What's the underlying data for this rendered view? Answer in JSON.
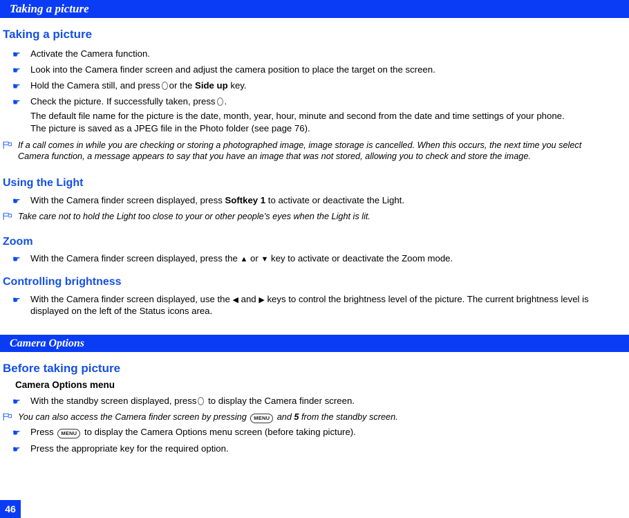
{
  "document": {
    "header_title": "Taking a picture",
    "page_number": "46"
  },
  "sections": {
    "taking_a_picture": {
      "heading": "Taking a picture",
      "steps": [
        "Activate the Camera function.",
        "Look into the Camera finder screen and adjust the camera position to place the target on the screen.",
        "Hold the Camera still, and press",
        "Check the picture. If successfully taken, press"
      ],
      "step3_suffix_a": "or the",
      "step3_bold": "Side up",
      "step3_suffix_b": "key.",
      "step4_suffix": ".",
      "continuation": [
        "The default file name for the picture is the date, month, year, hour, minute and second from the date and time settings of your phone.",
        "The picture is saved as a JPEG file in the Photo folder (see page 76)."
      ],
      "note_line1": "If a call comes in while you are checking or storing a photographed image, image storage is cancelled. When this occurs, the next time you select",
      "note_line2": "Camera function, a message appears to say that you have an image that was not stored, allowing you to check and store the image."
    },
    "using_the_light": {
      "heading": "Using the Light",
      "step_prefix": "With the Camera finder screen displayed, press",
      "step_bold": "Softkey 1",
      "step_suffix": "to activate or deactivate the Light.",
      "note": "Take care not to hold the Light too close to your or other people’s eyes when the Light is lit."
    },
    "zoom": {
      "heading": "Zoom",
      "step_prefix": "With the Camera finder screen displayed, press the",
      "step_mid": "or",
      "step_suffix": "key to activate or deactivate the Zoom mode.",
      "up_arrow": "▲",
      "down_arrow": "▼"
    },
    "controlling_brightness": {
      "heading": "Controlling brightness",
      "step_prefix": "With the Camera finder screen displayed, use the",
      "step_mid": "and",
      "step_suffix": "keys to control the brightness level of the picture. The current brightness level is",
      "step_line2": "displayed on the left of the Status icons area.",
      "left_arrow": "◀",
      "right_arrow": "▶"
    },
    "camera_options": {
      "bar_title": "Camera Options",
      "heading": "Before taking picture",
      "subheading": "Camera Options menu",
      "step1_prefix": "With the standby screen displayed, press",
      "step1_suffix": "to display the Camera finder screen.",
      "note_prefix": "You can also access the Camera finder screen by pressing",
      "note_mid": "and",
      "note_bold": "5",
      "note_suffix": "from the standby screen.",
      "step2_prefix": "Press",
      "step2_suffix": "to display the Camera Options menu screen (before taking picture).",
      "step3": "Press the appropriate key for the required option."
    }
  },
  "icons": {
    "hand_bullet": "☛",
    "menu_key_label": "MENU",
    "note_flag": "note-flag-icon",
    "ok_key": "ok-circle-key-icon"
  },
  "colors": {
    "brand_blue": "#0a3cf5",
    "heading_blue": "#1450e6",
    "bullet_blue": "#0a49f0"
  }
}
